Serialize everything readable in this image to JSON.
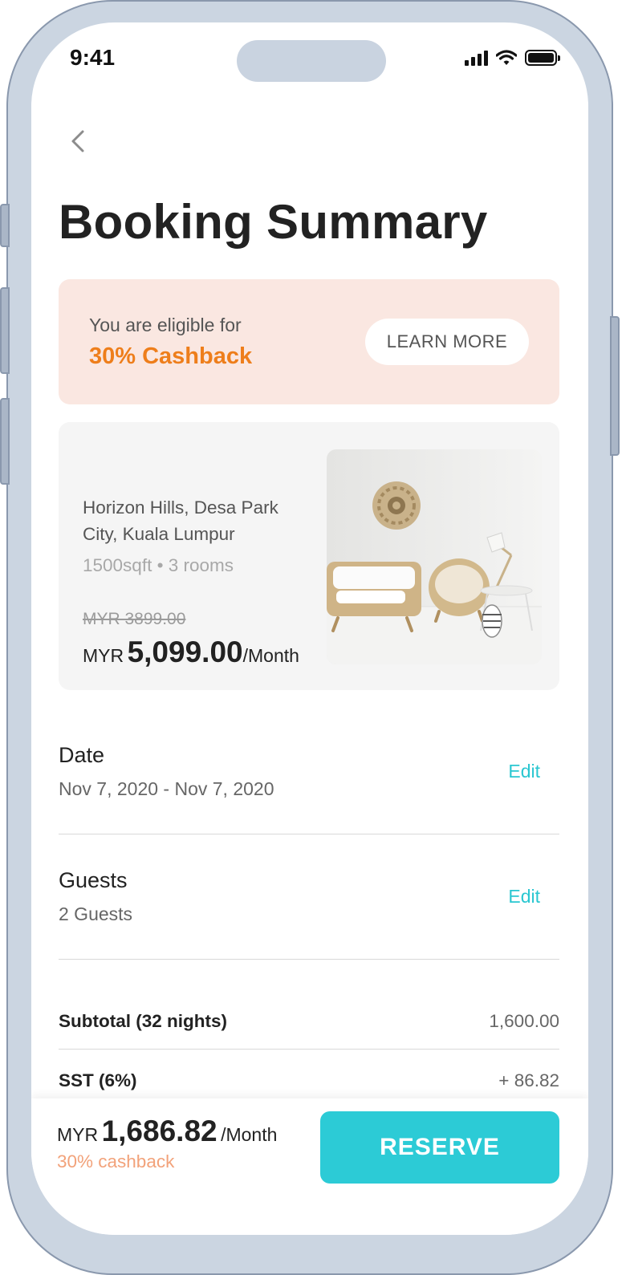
{
  "status_bar": {
    "time": "9:41"
  },
  "header": {
    "title": "Booking Summary"
  },
  "banner": {
    "eligible_text": "You are eligible for",
    "cashback_text": "30% Cashback",
    "learn_more_label": "LEARN MORE"
  },
  "listing": {
    "address": "Horizon Hills, Desa Park City, Kuala Lumpur",
    "meta": "1500sqft • 3 rooms",
    "old_price": "MYR  3899.00",
    "currency": "MYR",
    "price": "5,099.00",
    "period": "/Month"
  },
  "date": {
    "label": "Date",
    "value": "Nov 7, 2020 - Nov 7, 2020",
    "edit_label": "Edit"
  },
  "guests": {
    "label": "Guests",
    "value": "2 Guests",
    "edit_label": "Edit"
  },
  "breakdown": [
    {
      "label": "Subtotal (32 nights)",
      "value": "1,600.00"
    },
    {
      "label": "SST (6%)",
      "value": "+ 86.82"
    }
  ],
  "footer": {
    "currency": "MYR",
    "total": "1,686.82",
    "period": "/Month",
    "cashback": "30% cashback",
    "reserve_label": "RESERVE"
  },
  "colors": {
    "accent": "#2ccbd6",
    "cashback": "#ee7e1b",
    "banner_bg": "#fae7e1"
  }
}
